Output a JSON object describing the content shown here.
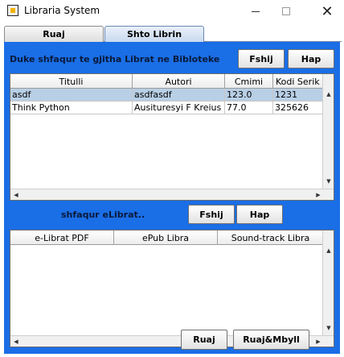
{
  "window": {
    "title": "Libraria System",
    "controls": {
      "minimize": "–",
      "close": "✕"
    }
  },
  "tabs": [
    {
      "label": "Ruaj",
      "selected": false
    },
    {
      "label": "Shto Librin",
      "selected": true
    }
  ],
  "books_section": {
    "title": "Duke shfaqur te gjitha Librat ne Bibloteke",
    "delete_button": "Fshij",
    "open_button": "Hap",
    "columns": [
      "Titulli",
      "Autori",
      "Cmimi",
      "Kodi Serik"
    ],
    "rows": [
      [
        "asdf",
        "asdfasdf",
        "123.0",
        "1231"
      ],
      [
        "Think Python",
        "Ausituresyi F Kreius",
        "77.0",
        "325626"
      ]
    ],
    "selected_row": 0
  },
  "ebooks_section": {
    "title": "shfaqur eLibrat..",
    "delete_button": "Fshij",
    "open_button": "Hap",
    "columns": [
      "e-Librat PDF",
      "ePub Libra",
      "Sound-track Libra"
    ]
  },
  "footer": {
    "save_button": "Ruaj",
    "save_close_button": "Ruaj&Mbyll"
  },
  "colors": {
    "panel_bg": "#1a6ee6",
    "selected_row": "#b8cfe5"
  }
}
